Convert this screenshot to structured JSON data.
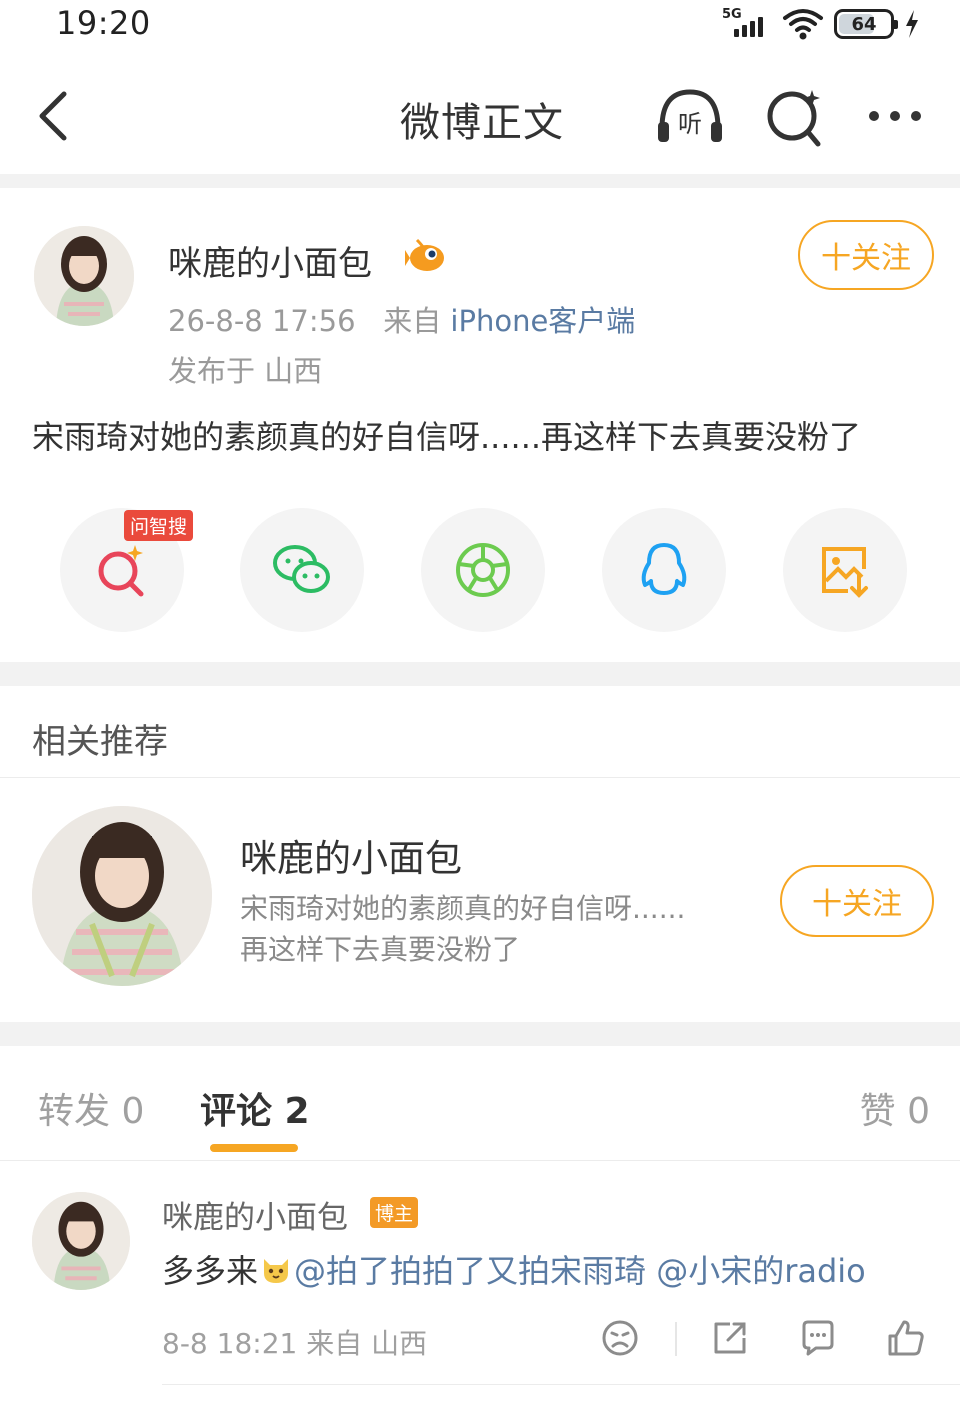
{
  "status": {
    "time": "19:20",
    "network": "5G",
    "battery": "64"
  },
  "nav": {
    "title": "微博正文",
    "listen_label": "听"
  },
  "post": {
    "author": "咪鹿的小面包",
    "time": "26-8-8 17:56",
    "source_prefix": "来自",
    "source": "iPhone客户端",
    "location": "发布于 山西",
    "follow_label": "十关注",
    "text": "宋雨琦对她的素颜真的好自信呀......再这样下去真要没粉了"
  },
  "share": {
    "ai_badge": "问智搜",
    "items": [
      "ai-search",
      "wechat",
      "moments",
      "qq",
      "save-image"
    ]
  },
  "recommend": {
    "section_title": "相关推荐",
    "name": "咪鹿的小面包",
    "desc_line1": "宋雨琦对她的素颜真的好自信呀......",
    "desc_line2": "再这样下去真要没粉了",
    "follow_label": "十关注"
  },
  "tabs": {
    "repost": "转发 0",
    "comment": "评论 2",
    "like": "赞 0"
  },
  "comment": {
    "author": "咪鹿的小面包",
    "badge": "博主",
    "text_prefix": "多多来",
    "mention1": "@拍了拍拍了又拍宋雨琦",
    "mention2": "@小宋的radio",
    "meta": "8-8 18:21 来自 山西"
  },
  "colors": {
    "accent": "#f6a623",
    "link": "#5a7ba3",
    "badge_red": "#ea4a3c"
  }
}
